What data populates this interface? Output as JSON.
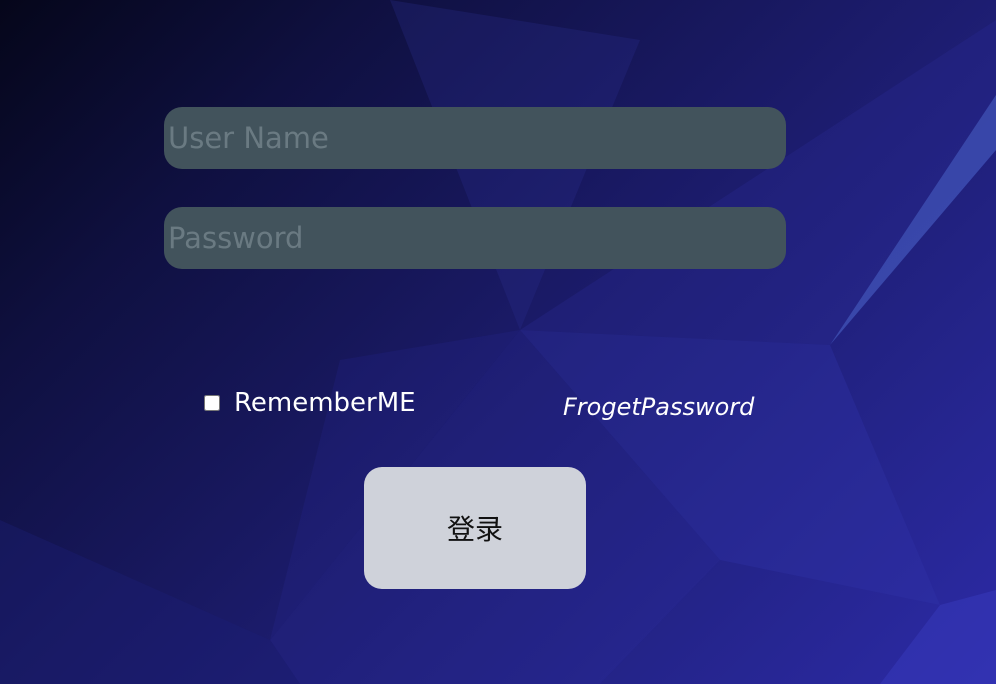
{
  "login_form": {
    "username_placeholder": "User Name",
    "password_placeholder": "Password",
    "remember_label": "RememberME",
    "forgot_label": "FrogetPassword",
    "login_label": "登录"
  },
  "colors": {
    "background_dark": "#05061a",
    "background_light": "#2c2aa6",
    "input_fill": "#42535c",
    "button_fill": "#cfd2da"
  }
}
